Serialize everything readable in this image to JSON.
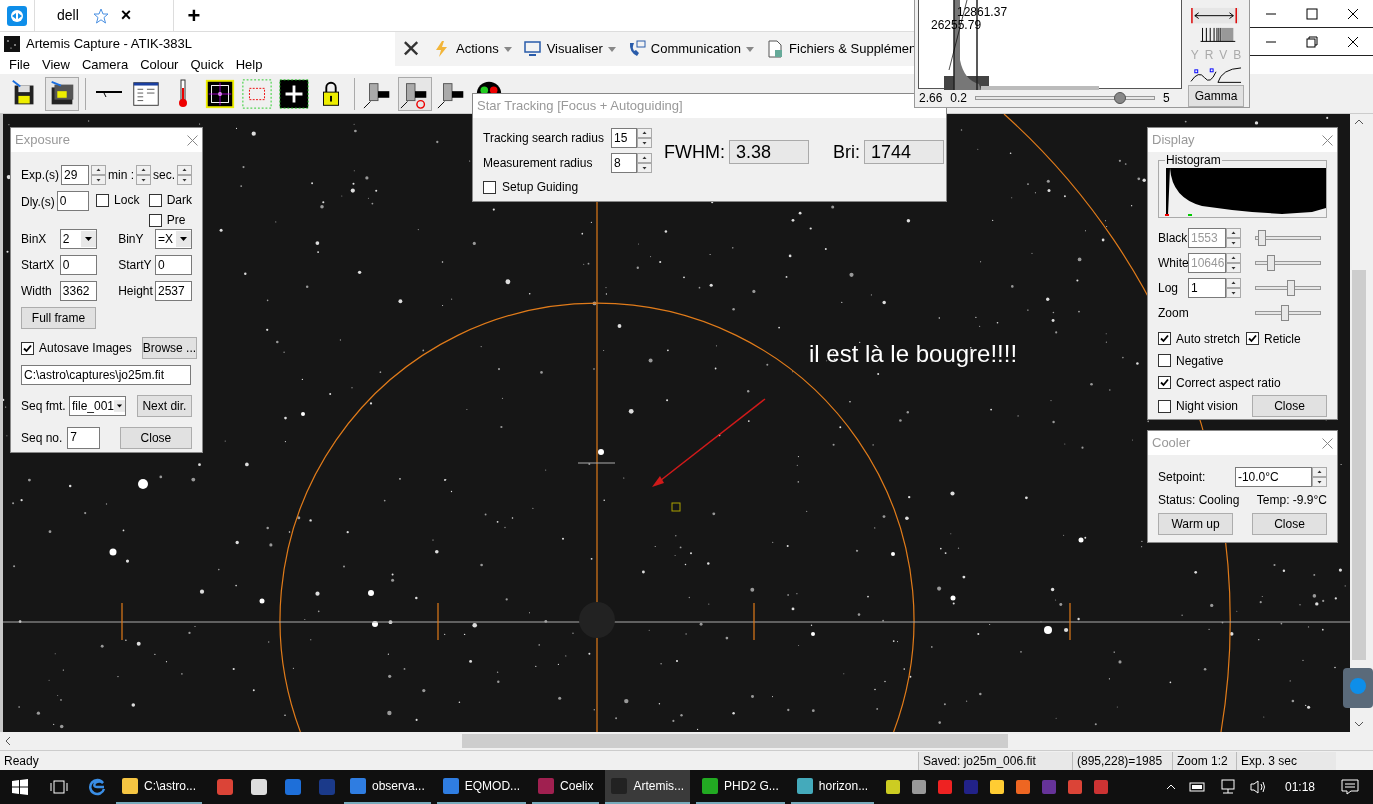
{
  "browser_tab": {
    "title": "dell",
    "close": "×",
    "new_tab": "+"
  },
  "window": {
    "title": "Artemis Capture - ATIK-383L"
  },
  "remote_toolbar": {
    "close": "✕",
    "items": [
      {
        "label": "Actions"
      },
      {
        "label": "Visualiser"
      },
      {
        "label": "Communication"
      },
      {
        "label": "Fichiers & Supplémen"
      }
    ]
  },
  "menu": [
    "File",
    "View",
    "Camera",
    "Colour",
    "Quick",
    "Help"
  ],
  "histogram_window": {
    "peak_labels": [
      "12861.37",
      "26255.79"
    ],
    "min": "2.66",
    "gamma_low": "0.2",
    "gamma_high": "5",
    "gamma_slider": {
      "level": 0.83
    },
    "channels": [
      "Y",
      "R",
      "V",
      "B"
    ],
    "gamma_button": "Gamma"
  },
  "exposure": {
    "title": "Exposure",
    "exp_label": "Exp.(s)",
    "exp_value": "29",
    "min_label": "min :",
    "sec_label": "sec.",
    "dly_label": "Dly.(s)",
    "dly_value": "0",
    "checks": [
      {
        "label": "Lock",
        "checked": false
      },
      {
        "label": "Dark",
        "checked": false
      },
      {
        "label": "Pre",
        "checked": false
      }
    ],
    "binx_label": "BinX",
    "binx_value": "2",
    "biny_label": "BinY",
    "biny_value": "=X",
    "fields": [
      {
        "label": "StartX",
        "value": "0"
      },
      {
        "label": "StartY",
        "value": "0"
      },
      {
        "label": "Width",
        "value": "3362"
      },
      {
        "label": "Height",
        "value": "2537"
      }
    ],
    "full_frame": "Full frame",
    "autosave": {
      "label": "Autosave Images",
      "checked": true
    },
    "browse": "Browse ...",
    "path": "C:\\astro\\captures\\jo25m.fit",
    "seq_fmt_label": "Seq fmt.",
    "seq_fmt_value": "file_001",
    "next_dir": "Next dir.",
    "seq_no_label": "Seq no.",
    "seq_no_value": "7",
    "close": "Close"
  },
  "star_tracking": {
    "title": "Star Tracking [Focus + Autoguiding]",
    "search_label": "Tracking search radius",
    "search_value": "15",
    "measure_label": "Measurement radius",
    "measure_value": "8",
    "setup_guiding": {
      "label": "Setup Guiding",
      "checked": false
    },
    "fwhm_label": "FWHM:",
    "fwhm_value": "3.38",
    "bri_label": "Bri:",
    "bri_value": "1744"
  },
  "display": {
    "title": "Display",
    "histogram_label": "Histogram",
    "rows": [
      {
        "kind": "spin",
        "label": "Black",
        "value": "1553",
        "disabled": true,
        "level": 0.05
      },
      {
        "kind": "spin",
        "label": "White",
        "value": "10646",
        "disabled": true,
        "level": 0.2
      },
      {
        "kind": "spin",
        "label": "Log",
        "value": "1",
        "disabled": false,
        "level": 0.55
      },
      {
        "kind": "slider",
        "label": "Zoom",
        "level": 0.45
      }
    ],
    "checks": [
      {
        "label": "Auto stretch",
        "checked": true
      },
      {
        "label": "Reticle",
        "checked": true
      },
      {
        "label": "Negative",
        "checked": false
      },
      {
        "label": "Correct aspect ratio",
        "checked": true
      },
      {
        "label": "Night vision",
        "checked": false
      }
    ],
    "close": "Close"
  },
  "cooler": {
    "title": "Cooler",
    "setpoint_label": "Setpoint:",
    "setpoint_value": "-10.0°C",
    "status": "Status: Cooling",
    "temp": "Temp: -9.9°C",
    "warm_up": "Warm up",
    "close": "Close"
  },
  "annotation": "il est là le bougre!!!!",
  "status_bar": [
    "Ready",
    "Saved: jo25m_006.fit",
    "(895,228)=1985",
    "Zoom 1:2",
    "Exp. 3 sec"
  ],
  "taskbar": {
    "apps": [
      {
        "label": "C:\\astro...",
        "selected": false
      },
      {
        "label": "observa...",
        "selected": false
      },
      {
        "label": "EQMOD...",
        "selected": false
      },
      {
        "label": "Coelix",
        "selected": false
      },
      {
        "label": "Artemis...",
        "selected": true
      },
      {
        "label": "PHD2 G...",
        "selected": false
      },
      {
        "label": "horizon...",
        "selected": false
      }
    ],
    "time": "01:18"
  }
}
